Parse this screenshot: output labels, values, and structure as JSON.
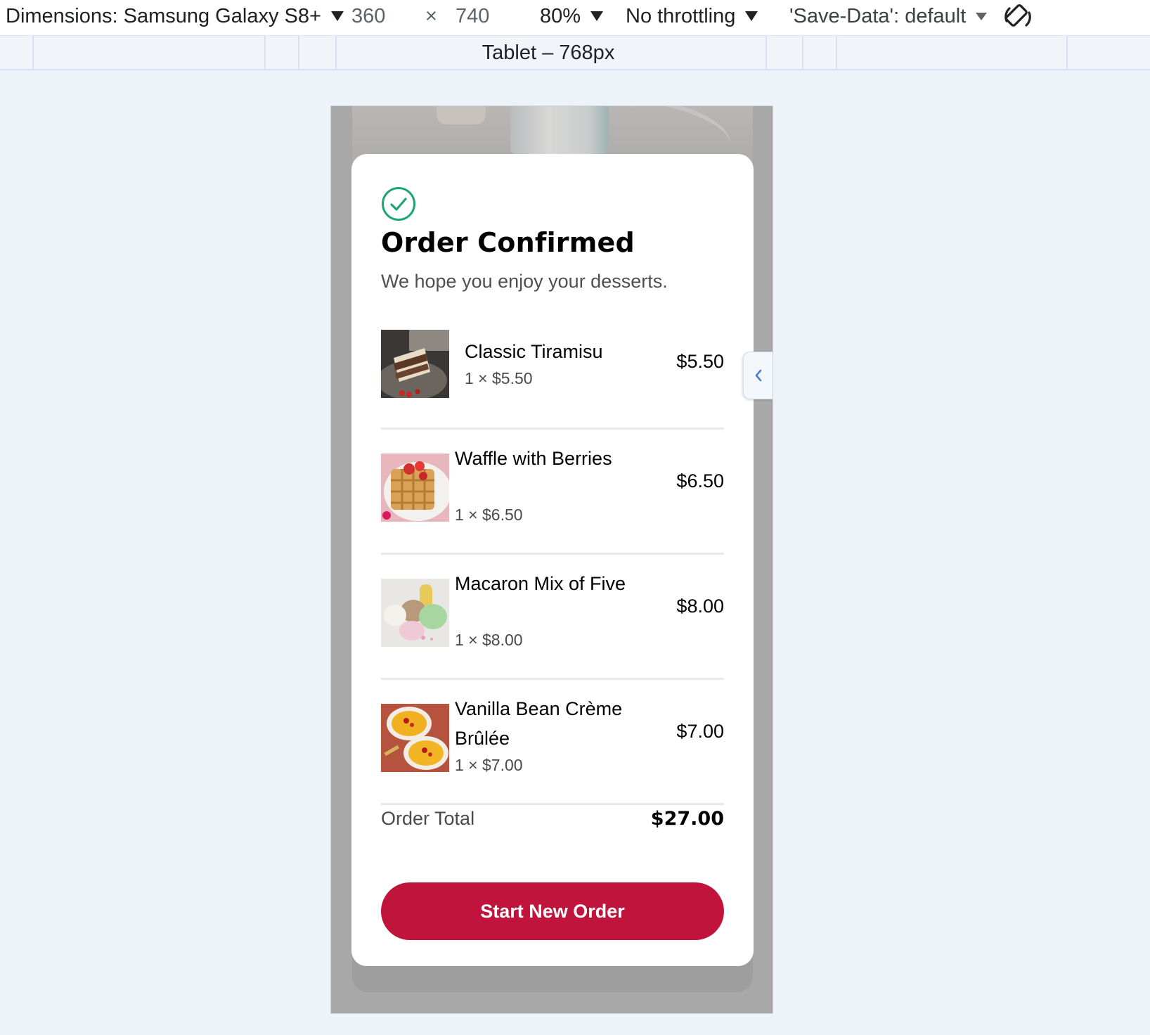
{
  "toolbar": {
    "dimensions_label": "Dimensions: Samsung Galaxy S8+",
    "width": "360",
    "times": "×",
    "height": "740",
    "zoom": "80%",
    "throttling": "No throttling",
    "save_data": "'Save-Data': default",
    "rotate_icon": "rotate-icon"
  },
  "media_bar": {
    "label": "Tablet – 768px"
  },
  "order": {
    "check_icon": "check-circle-icon",
    "title": "Order Confirmed",
    "subtitle": "We hope you enjoy your desserts.",
    "items": [
      {
        "name": "Classic Tiramisu",
        "qty": "1 × $5.50",
        "price": "$5.50"
      },
      {
        "name": "Waffle with Berries",
        "qty": "1 × $6.50",
        "price": "$6.50"
      },
      {
        "name": "Macaron Mix of Five",
        "qty": "1 × $8.00",
        "price": "$8.00"
      },
      {
        "name": "Vanilla Bean Crème Brûlée",
        "qty": "1 × $7.00",
        "price": "$7.00"
      }
    ],
    "total_label": "Order Total",
    "total_value": "$27.00",
    "cta_label": "Start New Order"
  },
  "colors": {
    "accent": "#c0143c",
    "check": "#1ea475",
    "page_bg": "#eef2f9"
  }
}
